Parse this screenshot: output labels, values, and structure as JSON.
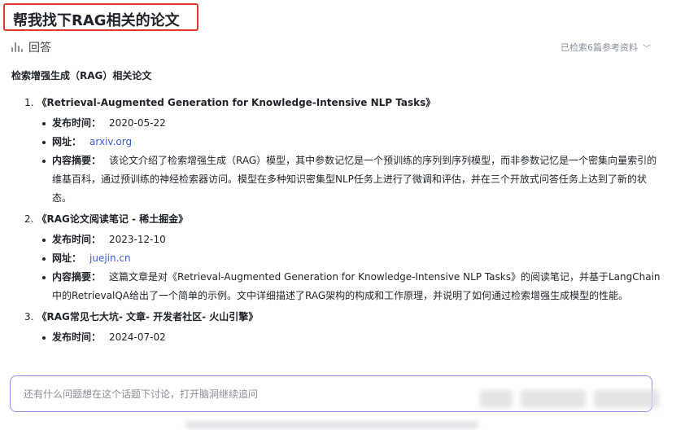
{
  "query": {
    "text": "帮我找下RAG相关的论文"
  },
  "answer": {
    "label": "回答",
    "sources_text": "已检索6篇参考资料"
  },
  "section_title": "检索增强生成（RAG）相关论文",
  "papers": [
    {
      "num": "1.",
      "title": "《Retrieval-Augmented Generation for Knowledge-Intensive NLP Tasks》",
      "date_label": "发布时间：",
      "date": "2020-05-22",
      "url_label": "网址：",
      "url": "arxiv.org",
      "summary_label": "内容摘要：",
      "summary": "该论文介绍了检索增强生成（RAG）模型，其中参数记忆是一个预训练的序列到序列模型，而非参数记忆是一个密集向量索引的维基百科，通过预训练的神经检索器访问。模型在多种知识密集型NLP任务上进行了微调和评估，并在三个开放式问答任务上达到了新的状态。"
    },
    {
      "num": "2.",
      "title": "《RAG论文阅读笔记 - 稀土掘金》",
      "date_label": "发布时间：",
      "date": "2023-12-10",
      "url_label": "网址：",
      "url": "juejin.cn",
      "summary_label": "内容摘要：",
      "summary": "这篇文章是对《Retrieval-Augmented Generation for Knowledge-Intensive NLP Tasks》的阅读笔记，并基于LangChain中的RetrievalQA给出了一个简单的示例。文中详细描述了RAG架构的构成和工作原理，并说明了如何通过检索增强生成模型的性能。"
    },
    {
      "num": "3.",
      "title": "《RAG常见七大坑- 文章- 开发者社区- 火山引擎》",
      "date_label": "发布时间：",
      "date": "2024-07-02"
    }
  ],
  "input": {
    "placeholder": "还有什么问题想在这个话题下讨论，打开脑洞继续追问"
  },
  "colors": {
    "highlight_border": "#e03a2f",
    "link": "#3d5bd9",
    "input_border": "#9a8cf0"
  }
}
